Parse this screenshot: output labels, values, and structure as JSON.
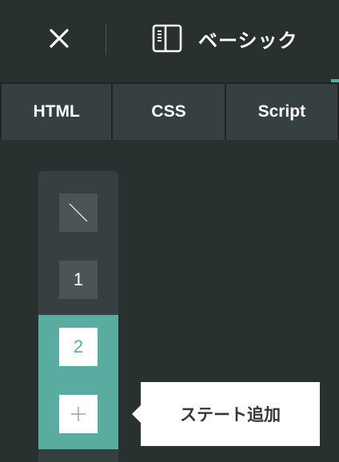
{
  "header": {
    "close_icon": "close-icon",
    "mode_icon": "panel-layout-icon",
    "mode_label": "ベーシック",
    "accent_color": "#5aaca0"
  },
  "tabs": [
    {
      "label": "HTML"
    },
    {
      "label": "CSS"
    },
    {
      "label": "Script"
    }
  ],
  "states": {
    "none_icon": "no-state-slash-icon",
    "items": [
      {
        "label": "1"
      },
      {
        "label": "2",
        "selected": true
      }
    ],
    "add_icon": "plus-icon"
  },
  "tooltip": {
    "text": "ステート追加"
  }
}
